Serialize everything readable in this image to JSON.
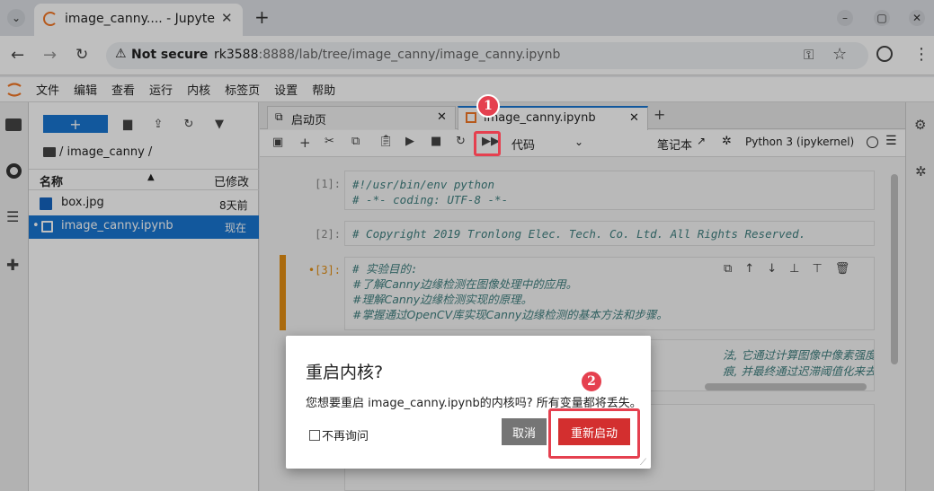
{
  "browser": {
    "tab_title": "image_canny.... - Jupyte",
    "new_tab": "+",
    "security_label": "Not secure",
    "url_host": "rk3588",
    "url_rest": ":8888/lab/tree/image_canny/image_canny.ipynb"
  },
  "menu": [
    "文件",
    "编辑",
    "查看",
    "运行",
    "内核",
    "标签页",
    "设置",
    "帮助"
  ],
  "filebrowser": {
    "new_label": "+",
    "breadcrumb": "/ image_canny /",
    "col_name": "名称",
    "col_modified": "已修改",
    "files": [
      {
        "name": "box.jpg",
        "modified": "8天前",
        "selected": false
      },
      {
        "name": "image_canny.ipynb",
        "modified": "现在",
        "selected": true
      }
    ]
  },
  "tabs": {
    "launcher": "启动页",
    "notebook": "image_canny.ipynb",
    "add": "+"
  },
  "toolbar": {
    "cell_type": "代码",
    "notebook_label": "笔记本",
    "kernel": "Python 3 (ipykernel)"
  },
  "cells": [
    {
      "prompt": "[1]:",
      "lines": [
        "#!/usr/bin/env python",
        "# -*- coding: UTF-8 -*-"
      ]
    },
    {
      "prompt": "[2]:",
      "lines": [
        "# Copyright 2019 Tronlong Elec. Tech. Co. Ltd. All Rights Reserved."
      ]
    },
    {
      "prompt": "•[3]:",
      "lines": [
        "# 实验目的:",
        "#了解Canny边缘检测在图像处理中的应用。",
        "#理解Canny边缘检测实现的原理。",
        "#掌握通过OpenCV库实现Canny边缘检测的基本方法和步骤。"
      ]
    }
  ],
  "cell4_partial": {
    "line1": "法, 它通过计算图像中像素强度梯度的局部",
    "line2": "痕, 并最终通过迟滞阈值化来去除假边缘。"
  },
  "dialog": {
    "title": "重启内核?",
    "body": "您想要重启 image_canny.ipynb的内核吗? 所有变量都将丢失。",
    "checkbox": "不再询问",
    "cancel": "取消",
    "confirm": "重新启动"
  },
  "annotations": [
    "1",
    "2"
  ],
  "colors": {
    "accent": "#1976d2",
    "danger": "#d32f2f",
    "annotation": "#e5404f",
    "cancel": "#757575"
  }
}
